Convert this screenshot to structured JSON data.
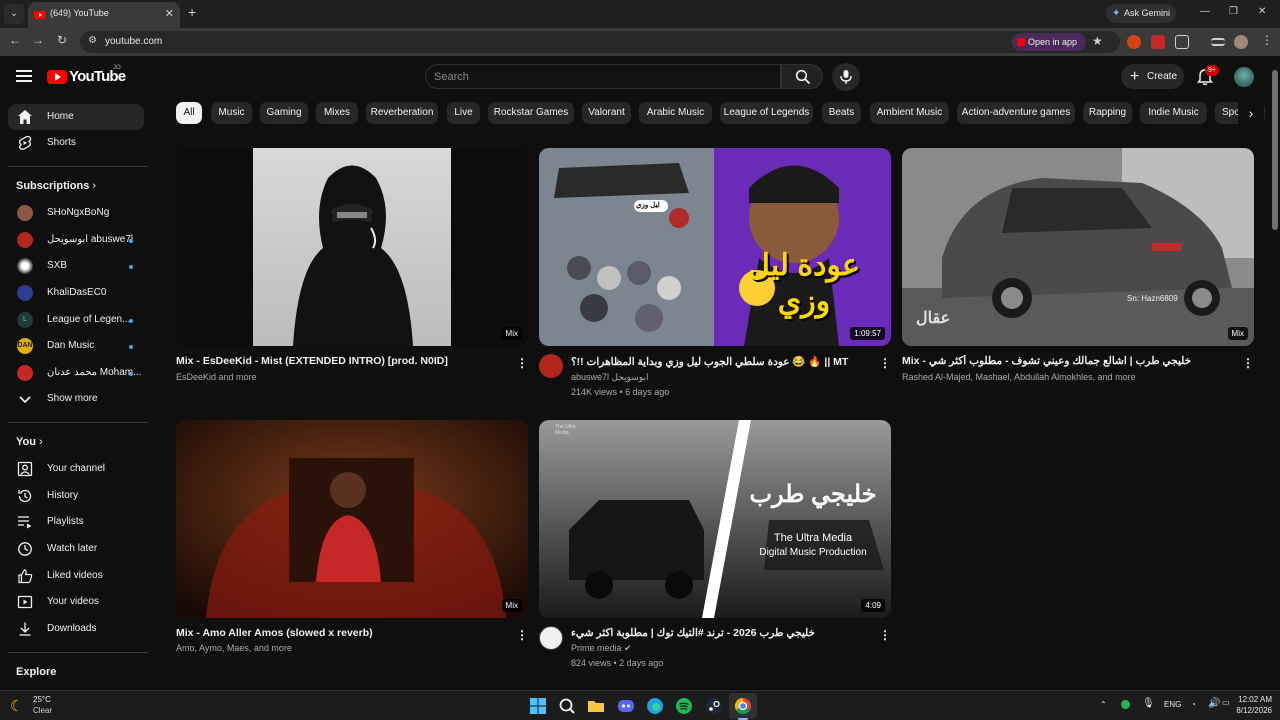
{
  "browser": {
    "tab_title": "(649) YouTube",
    "tab_close": "✕",
    "new_tab": "+",
    "ask_gemini": "Ask Gemini",
    "url": "youtube.com",
    "open_in_app": "Open in app"
  },
  "header": {
    "logo_text": "YouTube",
    "country_code": "JO",
    "search_placeholder": "Search",
    "create_label": "Create",
    "notification_badge": "9+"
  },
  "sidebar": {
    "main": [
      {
        "label": "Home",
        "icon": "home-icon",
        "active": true
      },
      {
        "label": "Shorts",
        "icon": "shorts-icon"
      }
    ],
    "subscriptions_heading": "Subscriptions",
    "subscriptions": [
      {
        "label": "SHoNgxBoNg",
        "live_dot": false,
        "color": "#8a5a44"
      },
      {
        "label": "ابوسويحل abuswe7l",
        "live_dot": true,
        "color": "#b3261e"
      },
      {
        "label": "SXB",
        "live_dot": true,
        "color": "#e0e0e0"
      },
      {
        "label": "KhaliDasEC0",
        "live_dot": false,
        "color": "#2a3d8f"
      },
      {
        "label": "League of Legen...",
        "live_dot": true,
        "color": "#1e3a3a"
      },
      {
        "label": "Dan Music",
        "live_dot": true,
        "color": "#e0b000"
      },
      {
        "label": "محمد عدنان Moham...",
        "live_dot": true,
        "color": "#c62828"
      }
    ],
    "show_more": "Show more",
    "you_heading": "You",
    "you_items": [
      {
        "label": "Your channel",
        "icon": "your-channel-icon"
      },
      {
        "label": "History",
        "icon": "history-icon"
      },
      {
        "label": "Playlists",
        "icon": "playlists-icon"
      },
      {
        "label": "Watch later",
        "icon": "watch-later-icon"
      },
      {
        "label": "Liked videos",
        "icon": "liked-videos-icon"
      },
      {
        "label": "Your videos",
        "icon": "your-videos-icon"
      },
      {
        "label": "Downloads",
        "icon": "downloads-icon"
      }
    ],
    "explore_heading": "Explore"
  },
  "chips": [
    "All",
    "Music",
    "Gaming",
    "Mixes",
    "Reverberation",
    "Live",
    "Rockstar Games",
    "Valorant",
    "Arabic Music",
    "League of Legends",
    "Beats",
    "Ambient Music",
    "Action-adventure games",
    "Rapping",
    "Indie Music",
    "Spor"
  ],
  "videos": [
    {
      "title": "Mix - EsDeeKid - Mist (EXTENDED INTRO) [prod. N0ID]",
      "channel": "EsDeeKid and more",
      "badge": "Mix"
    },
    {
      "title": "عودة سلطي الجوب ليل وزي وبداية المظاهرات !!؟ 😂 🔥 || MT",
      "channel": "abuswe7l ابوسويحل",
      "stats": "214K views • 6 days ago",
      "duration": "1:09:57",
      "overlay": "عودة ليل وزي",
      "tag": "ليل وزي"
    },
    {
      "title": "Mix - خليجي طرب | اشالع جمالك وعيني تشوف - مطلوب أكثر شي",
      "channel": "Rashed Al-Majed, Mashael, Abdullah Almokhles, and more",
      "badge": "Mix",
      "watermark": "Sn: Hazn6809",
      "logo_text": "عقال"
    },
    {
      "title": "Mix - Amo Aller Amos (slowed x reverb)",
      "channel": "Amo, Aymo, Maes, and more",
      "badge": "Mix"
    },
    {
      "title": "خليجي طرب 2026 - ترند #التيك توك | مطلوبة اكثر شيء",
      "channel": "Prime media",
      "stats": "824 views • 2 days ago",
      "duration": "4:09",
      "overlay_ar": "خليجي طرب",
      "overlay_en1": "The Ultra Media",
      "overlay_en2": "Digital Music Production",
      "corner_logo": "The Ultra Media"
    }
  ],
  "taskbar": {
    "weather_temp": "25°C",
    "weather_desc": "Clear",
    "lang": "ENG",
    "time": "12:02 AM",
    "date": "8/12/2026"
  }
}
